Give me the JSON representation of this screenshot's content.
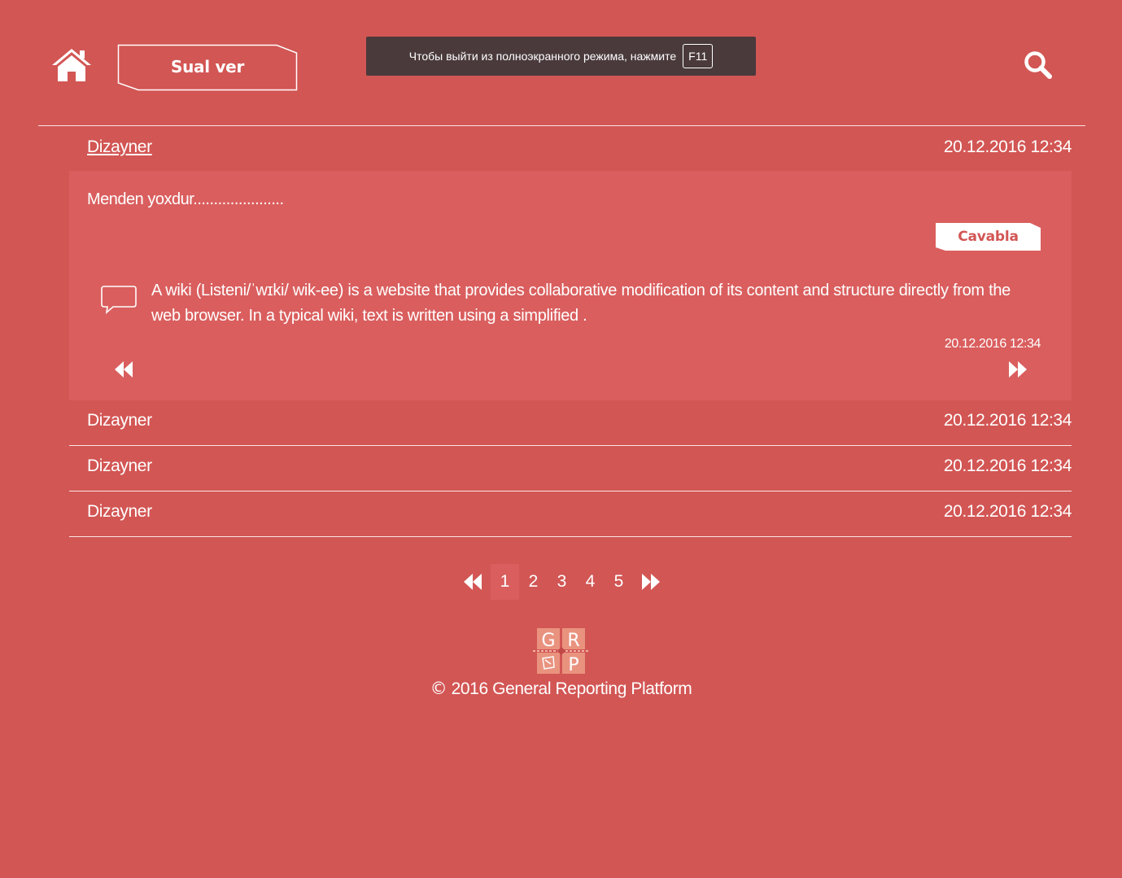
{
  "header": {
    "ask_button_label": "Sual ver",
    "fullscreen_notice": "Чтобы выйти из полноэкранного режима, нажмите",
    "fullscreen_key": "F11",
    "icons": [
      "home-icon",
      "search-icon"
    ]
  },
  "questions": [
    {
      "author": "Dizayner",
      "date": "20.12.2016 12:34",
      "expanded": true,
      "text": "Menden yoxdur......................",
      "answer_button_label": "Cavabla",
      "answer": {
        "text": "A wiki (Listeni/ˈwɪki/ wik-ee) is a website that provides collaborative modification of its content and structure directly from the web browser. In a typical wiki, text is written using a simplified .",
        "date": "20.12.2016 12:34"
      }
    },
    {
      "author": "Dizayner",
      "date": "20.12.2016 12:34",
      "expanded": false
    },
    {
      "author": "Dizayner",
      "date": "20.12.2016 12:34",
      "expanded": false
    },
    {
      "author": "Dizayner",
      "date": "20.12.2016 12:34",
      "expanded": false
    }
  ],
  "pagination": {
    "pages": [
      "1",
      "2",
      "3",
      "4",
      "5"
    ],
    "current": "1"
  },
  "footer": {
    "logo_letters": [
      "G",
      "R",
      "P"
    ],
    "copyright_symbol": "©",
    "copyright": " 2016 General Reporting Platform"
  },
  "colors": {
    "background": "#d25654",
    "panel": "#da5e5e",
    "toast": "#4a3a3c",
    "logo_tile": "#e9937f"
  }
}
